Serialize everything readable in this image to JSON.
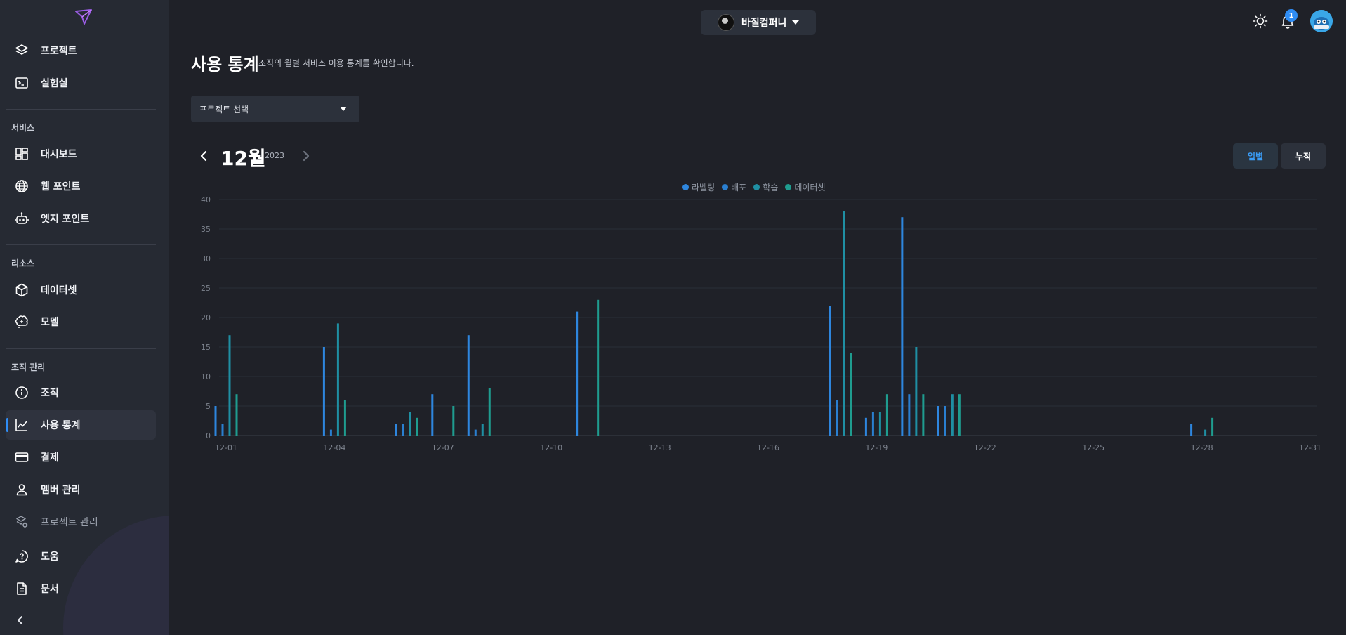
{
  "header": {
    "org_name": "바질컴퍼니",
    "notification_count": "1"
  },
  "sidebar": {
    "top_items": [
      {
        "label": "프로젝트",
        "icon": "layers-icon"
      },
      {
        "label": "실험실",
        "icon": "terminal-icon"
      }
    ],
    "sections": [
      {
        "title": "서비스",
        "items": [
          {
            "label": "대시보드",
            "icon": "dashboard-icon"
          },
          {
            "label": "웹 포인트",
            "icon": "globe-icon"
          },
          {
            "label": "엣지 포인트",
            "icon": "robot-icon"
          }
        ]
      },
      {
        "title": "리소스",
        "items": [
          {
            "label": "데이터셋",
            "icon": "cube-icon"
          },
          {
            "label": "모델",
            "icon": "brain-icon"
          }
        ]
      },
      {
        "title": "조직 관리",
        "items": [
          {
            "label": "조직",
            "icon": "info-icon"
          },
          {
            "label": "사용 통계",
            "icon": "chart-line-icon",
            "active": true
          },
          {
            "label": "결제",
            "icon": "credit-card-icon"
          },
          {
            "label": "멤버 관리",
            "icon": "user-icon"
          },
          {
            "label": "프로젝트 관리",
            "icon": "project-settings-icon",
            "muted": true
          }
        ]
      }
    ],
    "bottom_items": [
      {
        "label": "도움",
        "icon": "help-chat-icon"
      },
      {
        "label": "문서",
        "icon": "document-icon"
      }
    ]
  },
  "page": {
    "title": "사용 통계",
    "description": "조직의 월별 서비스 이용 통계를 확인합니다.",
    "project_select_placeholder": "프로젝트 선택",
    "month": "12월",
    "year": "2023",
    "toggle_daily": "일별",
    "toggle_cumulative": "누적"
  },
  "colors": {
    "accent": "#2f8df5",
    "labeling": "#2e86de",
    "deploy": "#2a7fd0",
    "training": "#1f8fa3",
    "dataset": "#1f9c8f"
  },
  "chart_data": {
    "type": "bar",
    "x": [
      "12-01",
      "12-02",
      "12-03",
      "12-04",
      "12-05",
      "12-06",
      "12-07",
      "12-08",
      "12-09",
      "12-10",
      "12-11",
      "12-12",
      "12-13",
      "12-14",
      "12-15",
      "12-16",
      "12-17",
      "12-18",
      "12-19",
      "12-20",
      "12-21",
      "12-22",
      "12-23",
      "12-24",
      "12-25",
      "12-26",
      "12-27",
      "12-28",
      "12-29",
      "12-30",
      "12-31"
    ],
    "tick_labels": [
      "12-01",
      "12-04",
      "12-07",
      "12-10",
      "12-13",
      "12-16",
      "12-19",
      "12-22",
      "12-25",
      "12-28",
      "12-31"
    ],
    "ylim": [
      0,
      40
    ],
    "yticks": [
      0,
      5,
      10,
      15,
      20,
      25,
      30,
      35,
      40
    ],
    "legend_position": "top-center",
    "series": [
      {
        "name": "라벨링",
        "color": "#2e86de",
        "values": [
          5,
          0,
          0,
          15,
          0,
          2,
          7,
          17,
          0,
          0,
          21,
          0,
          0,
          0,
          0,
          0,
          0,
          22,
          3,
          37,
          5,
          0,
          0,
          0,
          0,
          0,
          0,
          2,
          0,
          0,
          0
        ]
      },
      {
        "name": "배포",
        "color": "#2a7fd0",
        "values": [
          2,
          0,
          0,
          1,
          0,
          2,
          0,
          1,
          0,
          0,
          0,
          0,
          0,
          0,
          0,
          0,
          0,
          6,
          4,
          7,
          5,
          0,
          0,
          0,
          0,
          0,
          0,
          0,
          0,
          0,
          0
        ]
      },
      {
        "name": "학습",
        "color": "#1f8fa3",
        "values": [
          17,
          0,
          0,
          19,
          0,
          4,
          0,
          2,
          0,
          0,
          0,
          0,
          0,
          0,
          0,
          0,
          0,
          38,
          4,
          15,
          7,
          0,
          0,
          0,
          0,
          0,
          0,
          1,
          0,
          0,
          0
        ]
      },
      {
        "name": "데이터셋",
        "color": "#1f9c8f",
        "values": [
          7,
          0,
          0,
          6,
          0,
          3,
          5,
          8,
          0,
          0,
          23,
          0,
          0,
          0,
          0,
          0,
          0,
          14,
          7,
          7,
          7,
          0,
          0,
          0,
          0,
          0,
          0,
          3,
          0,
          0,
          0
        ]
      }
    ]
  }
}
